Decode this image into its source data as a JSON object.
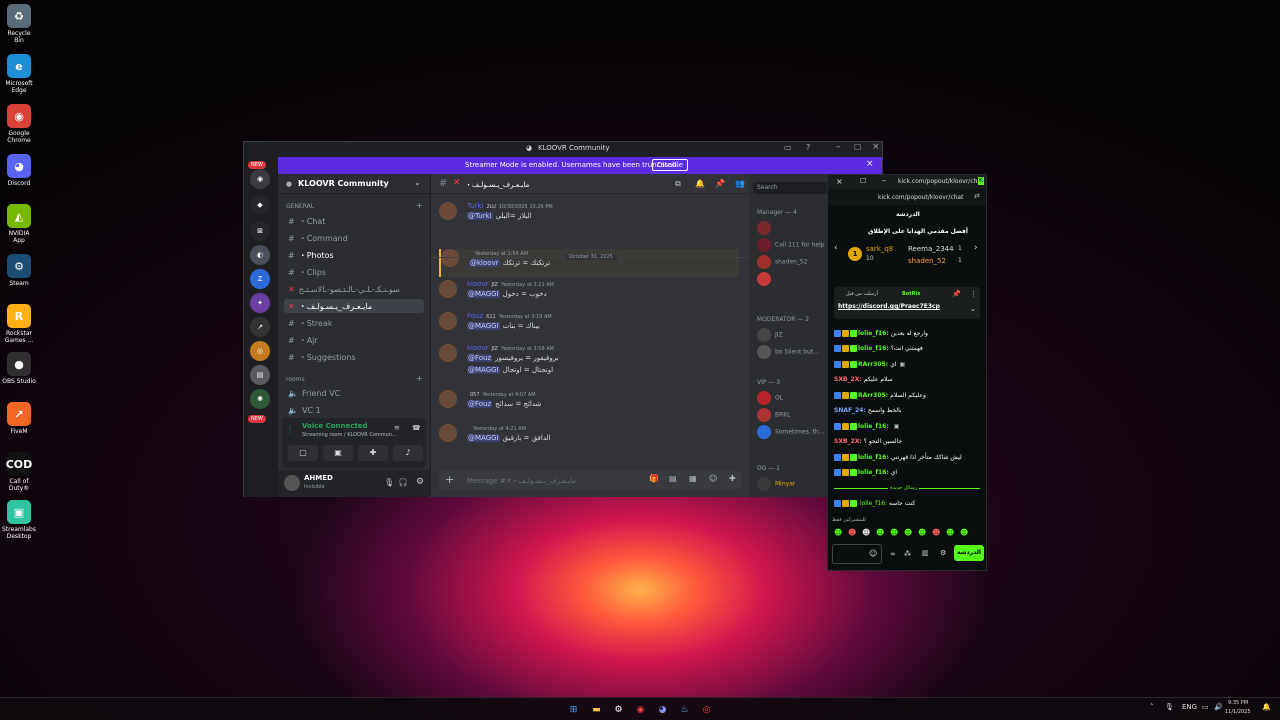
{
  "desktop": {
    "icons": [
      {
        "label": "Recycle Bin",
        "glyph": "♻",
        "bg": "#5a6b7a"
      },
      {
        "label": "Microsoft Edge",
        "glyph": "e",
        "bg": "#1c8fd6"
      },
      {
        "label": "Google Chrome",
        "glyph": "◉",
        "bg": "#d9433a"
      },
      {
        "label": "Discord",
        "glyph": "◕",
        "bg": "#5865f2"
      },
      {
        "label": "NVIDIA App",
        "glyph": "◭",
        "bg": "#76b900"
      },
      {
        "label": "Steam",
        "glyph": "⚙",
        "bg": "#1b4d75"
      },
      {
        "label": "Rockstar Games ...",
        "glyph": "R",
        "bg": "#fcaf17"
      },
      {
        "label": "OBS Studio",
        "glyph": "●",
        "bg": "#302e31"
      },
      {
        "label": "FiveM",
        "glyph": "↗",
        "bg": "#f26522"
      },
      {
        "label": "Call of Duty®",
        "glyph": "COD",
        "bg": "#111"
      },
      {
        "label": "Streamlabs Desktop",
        "glyph": "▣",
        "bg": "#31c3a2"
      }
    ]
  },
  "taskbar": {
    "lang": "ENG",
    "time": "9:35 PM",
    "date": "11/1/2025"
  },
  "discord": {
    "title": "KLOOVR Community",
    "banner_text": "Streamer Mode is enabled. Usernames have been truncated.",
    "banner_button": "Disable",
    "server_name": "KLOOVR Community",
    "new_badge": "NEW",
    "category_general": "GENERAL",
    "category_rooms": "rooms",
    "channels": [
      {
        "icon": "#",
        "label": "・Chat"
      },
      {
        "icon": "#",
        "label": "・Command"
      },
      {
        "icon": "#",
        "label": "・Photos"
      },
      {
        "icon": "#",
        "label": "・Clips"
      },
      {
        "icon": "✕",
        "label": "سوـنـكـ-ـلـي-ـالـتـصو-ـالاسـتـح"
      },
      {
        "icon": "✕",
        "label": "・مايـعـرف_يـسـولـف"
      },
      {
        "icon": "#",
        "label": "・Streak"
      },
      {
        "icon": "#",
        "label": "・Ajr"
      },
      {
        "icon": "#",
        "label": "・Suggestions"
      }
    ],
    "voice_channels": [
      "Friend VC",
      "VC 1"
    ],
    "voice_status": "Voice Connected",
    "voice_sub": "Streaming room / KLOOVR Commun...",
    "user_name": "AHMED",
    "user_status": "Invisible",
    "chat_header": "・مايـعـرف_يـسـولـف",
    "search_placeholder": "Search",
    "message_placeholder": "Message #✕・مايـعـرف_يـسـولـف",
    "date_divider": "October 31, 2025",
    "messages": [
      {
        "name": "Turki",
        "tag": "2LU",
        "time": "10/30/2025 10:26 PM",
        "mention": "@Turki",
        "text": "البلاز =البلي"
      },
      {
        "name": "",
        "tag": "",
        "time": "Yesterday at 1:54 AM",
        "mention": "@kloovr",
        "text": "ترتكتك = ترتكك"
      },
      {
        "name": "kloovr",
        "tag": "JIZ",
        "time": "Yesterday at 2:21 AM",
        "mention": "@MAGGI",
        "text": "دخوب = دخول"
      },
      {
        "name": "Fouz",
        "tag": "611",
        "time": "Yesterday at 3:19 AM",
        "mention": "@MAGGI",
        "text": "بيناك = بنات"
      },
      {
        "name": "kloovr",
        "tag": "JIZ",
        "time": "Yesterday at 3:58 AM",
        "mention": "@Fouz",
        "text": "بروفيفور = بروفيسور",
        "mention2": "@MAGGI",
        "text2": "اوتجتال = اوتجال"
      },
      {
        "name": "",
        "tag": "057",
        "time": "Yesterday at 4:07 AM",
        "mention": "@Fouz",
        "text": "شدائج = سدائج"
      },
      {
        "name": "",
        "tag": "",
        "time": "Yesterday at 4:21 AM",
        "mention": "@MAGGI",
        "text": "الدافق = بارقيق"
      }
    ],
    "member_sections": [
      {
        "title": "Manager — 4",
        "rows": [
          "",
          "Call 111 for help",
          "shaden_52",
          ""
        ]
      },
      {
        "title": "MODERATOR — 2",
        "rows": [
          "JIZ",
          "bo Silent but..."
        ]
      },
      {
        "title": "VIP — 3",
        "rows": [
          "OL",
          "BRKL",
          "Sometimes, th..."
        ]
      },
      {
        "title": "OG — 1",
        "rows": [
          "Minyar"
        ]
      }
    ]
  },
  "kick": {
    "url_short": "kick.com/popout/kloovr/ch...",
    "url": "kick.com/popout/kloovr/chat",
    "heading": "الدردشة",
    "top_label": "أفضل مقدمي الهدايا على الإطلاق",
    "gifters": [
      {
        "rank": "1",
        "name": "sark_q8",
        "count": "10"
      },
      {
        "name": "Reema_2344",
        "count": "1"
      },
      {
        "name": "shaden_52",
        "count": "1"
      }
    ],
    "pinned_by": "أرسلت من قبل",
    "pinned_user": "BotRix",
    "pinned_link": "https://discord.gg/Praec7E3cp",
    "lines": [
      {
        "user": "lolie_f16:",
        "text": "وارجع له بعدين",
        "color": "#53fc18"
      },
      {
        "user": "lolie_f16:",
        "text": "فهمتني انت؟",
        "color": "#53fc18"
      },
      {
        "user": "RArr305:",
        "text": "اي",
        "color": "#53fc18"
      },
      {
        "user": "SXB_2X:",
        "text": "سلام عليكم",
        "color": "#ff6b6b"
      },
      {
        "user": "RArr305:",
        "text": "وعليكم السلام",
        "color": "#53fc18"
      },
      {
        "user": "SNAF_24:",
        "text": "بالخط واسمح",
        "color": "#7aa8ff"
      },
      {
        "user": "lolie_f16:",
        "text": "",
        "color": "#53fc18"
      },
      {
        "user": "SXB_2X:",
        "text": "جالسين النحو ؟",
        "color": "#ff6b6b"
      },
      {
        "user": "lolie_f16:",
        "text": "ليش شاكك متأخر اذا قهرتني",
        "color": "#53fc18"
      },
      {
        "user": "lolie_f16:",
        "text": "اي",
        "color": "#53fc18"
      }
    ],
    "new_messages": "رسائل جديدة",
    "last_line": {
      "user": "lolie_f16:",
      "text": "كنت حاسه"
    },
    "subs_only": "للمشتركين فقط",
    "chat_button": "الدردشة"
  }
}
